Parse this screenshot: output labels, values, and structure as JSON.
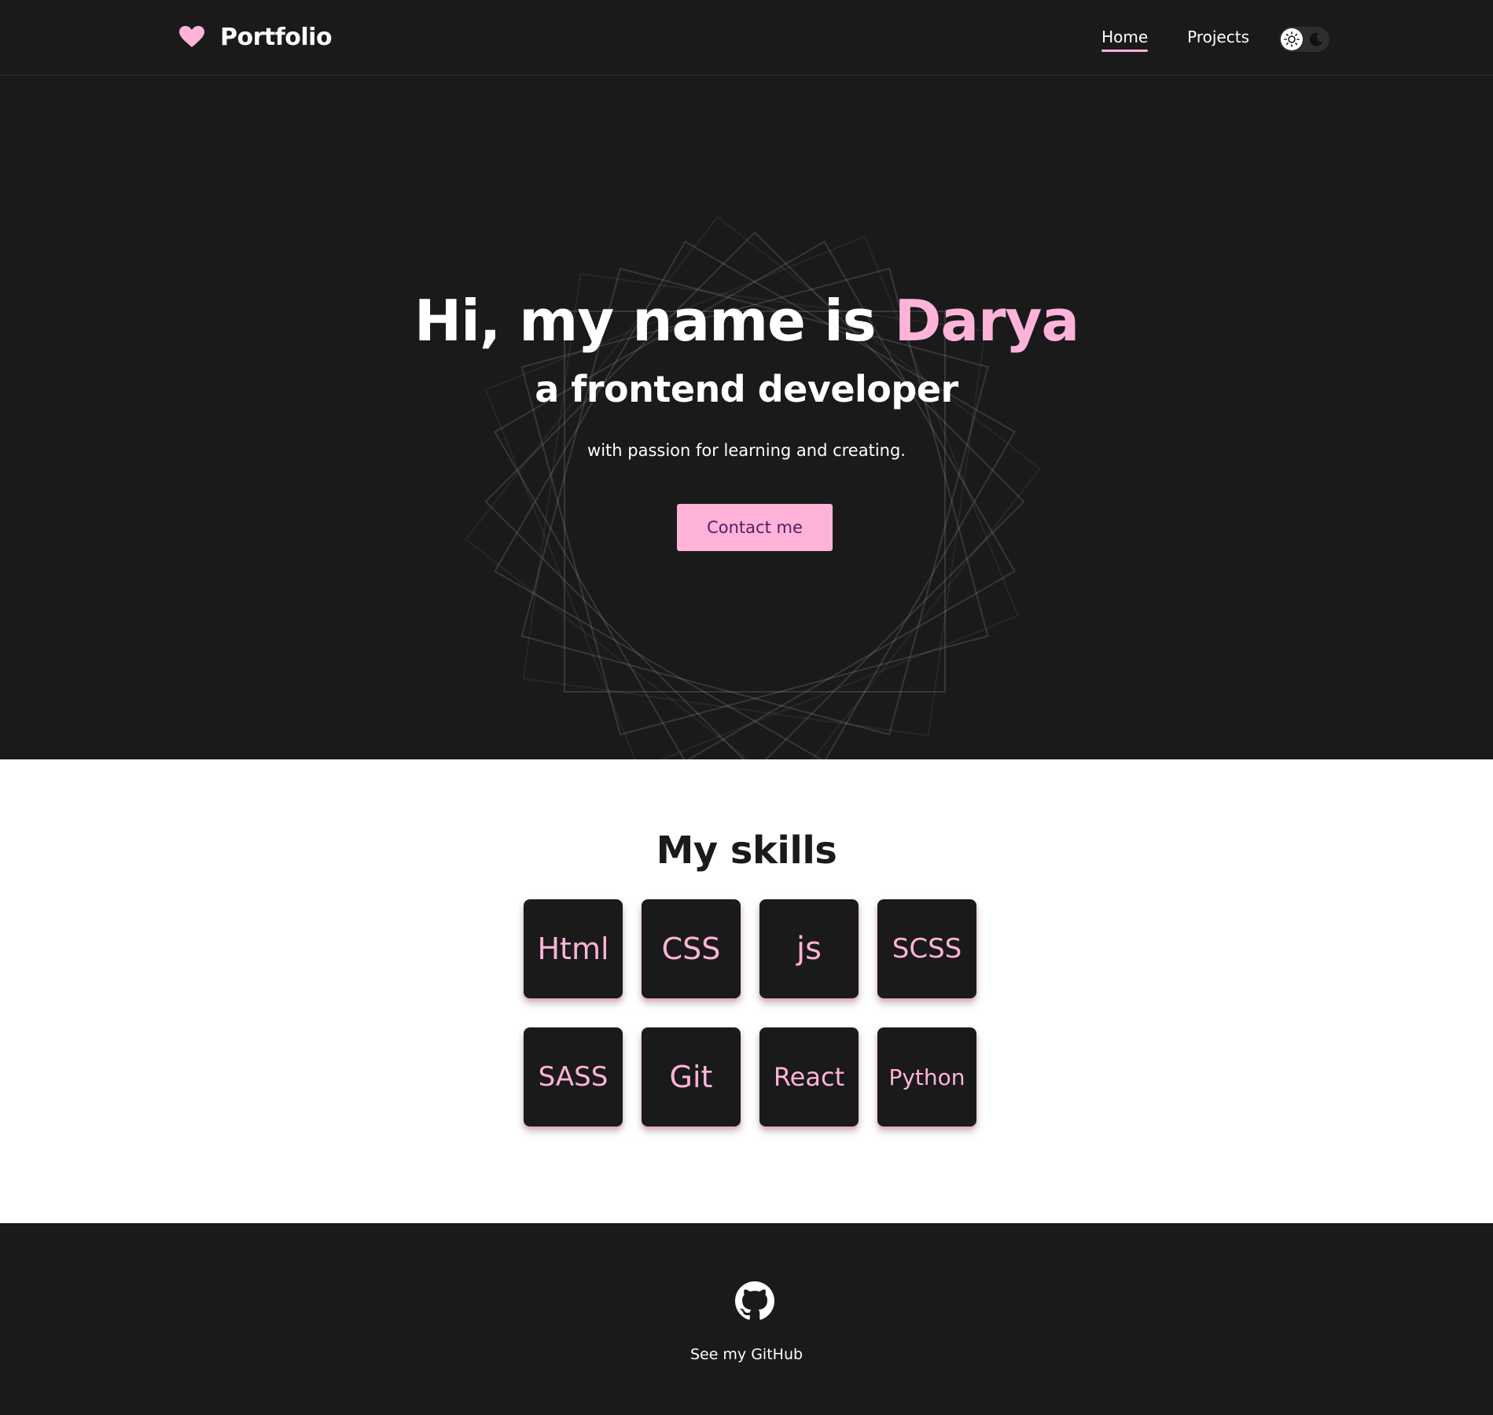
{
  "header": {
    "brand": "Portfolio",
    "nav": [
      {
        "label": "Home",
        "active": true
      },
      {
        "label": "Projects",
        "active": false
      }
    ],
    "theme_toggle": {
      "mode": "dark"
    }
  },
  "hero": {
    "title_prefix": "Hi, my name is ",
    "title_name": "Darya",
    "subtitle": "a frontend developer",
    "tagline": "with passion for learning and creating.",
    "cta_label": "Contact me"
  },
  "skills": {
    "title": "My skills",
    "items": [
      "Html",
      "CSS",
      "js",
      "SCSS",
      "SASS",
      "Git",
      "React",
      "Python"
    ]
  },
  "footer": {
    "github_label": "See my GitHub"
  },
  "colors": {
    "background_dark": "#1a1a1a",
    "accent_pink": "#ffb3d9",
    "button_text": "#5a1a66",
    "white": "#ffffff"
  },
  "icons": {
    "brand": "heart-icon",
    "theme_light": "sun-icon",
    "theme_dark": "moon-icon",
    "footer": "github-icon"
  }
}
